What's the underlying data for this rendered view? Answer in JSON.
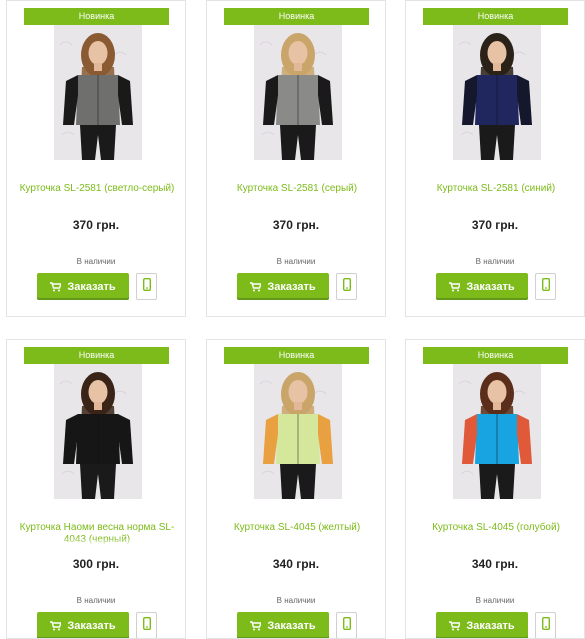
{
  "products": [
    {
      "badge": "Новинка",
      "name": "Курточка SL-2581 (светло-серый)",
      "price": "370 грн.",
      "stock": "В наличии",
      "order_label": "Заказать",
      "body_color": "#6f706d",
      "sleeve_color": "#1a1a1a",
      "hair_color": "#8a5a32"
    },
    {
      "badge": "Новинка",
      "name": "Курточка SL-2581 (серый)",
      "price": "370 грн.",
      "stock": "В наличии",
      "order_label": "Заказать",
      "body_color": "#8a8b88",
      "sleeve_color": "#1a1a1a",
      "hair_color": "#c9a56a"
    },
    {
      "badge": "Новинка",
      "name": "Курточка SL-2581 (синий)",
      "price": "370 грн.",
      "stock": "В наличии",
      "order_label": "Заказать",
      "body_color": "#20265e",
      "sleeve_color": "#15172c",
      "hair_color": "#2a2118"
    },
    {
      "badge": "Новинка",
      "name": "Курточка Наоми весна норма SL-4043 (черный)",
      "price": "300 грн.",
      "stock": "В наличии",
      "order_label": "Заказать",
      "body_color": "#161616",
      "sleeve_color": "#161616",
      "hair_color": "#3a2417"
    },
    {
      "badge": "Новинка",
      "name": "Курточка SL-4045 (желтый)",
      "price": "340 грн.",
      "stock": "В наличии",
      "order_label": "Заказать",
      "body_color": "#d4e79a",
      "sleeve_color": "#e8a040",
      "hair_color": "#c9a56a"
    },
    {
      "badge": "Новинка",
      "name": "Курточка SL-4045 (голубой)",
      "price": "340 грн.",
      "stock": "В наличии",
      "order_label": "Заказать",
      "body_color": "#17a4e0",
      "sleeve_color": "#e05a3a",
      "hair_color": "#5a2e1a"
    }
  ],
  "colors": {
    "accent": "#7cbb1a",
    "price": "#222222",
    "border": "#e3e3e3",
    "photo_bg": "#ececec"
  },
  "icons": {
    "order_button": "cart-icon",
    "call_button": "phone-icon"
  }
}
